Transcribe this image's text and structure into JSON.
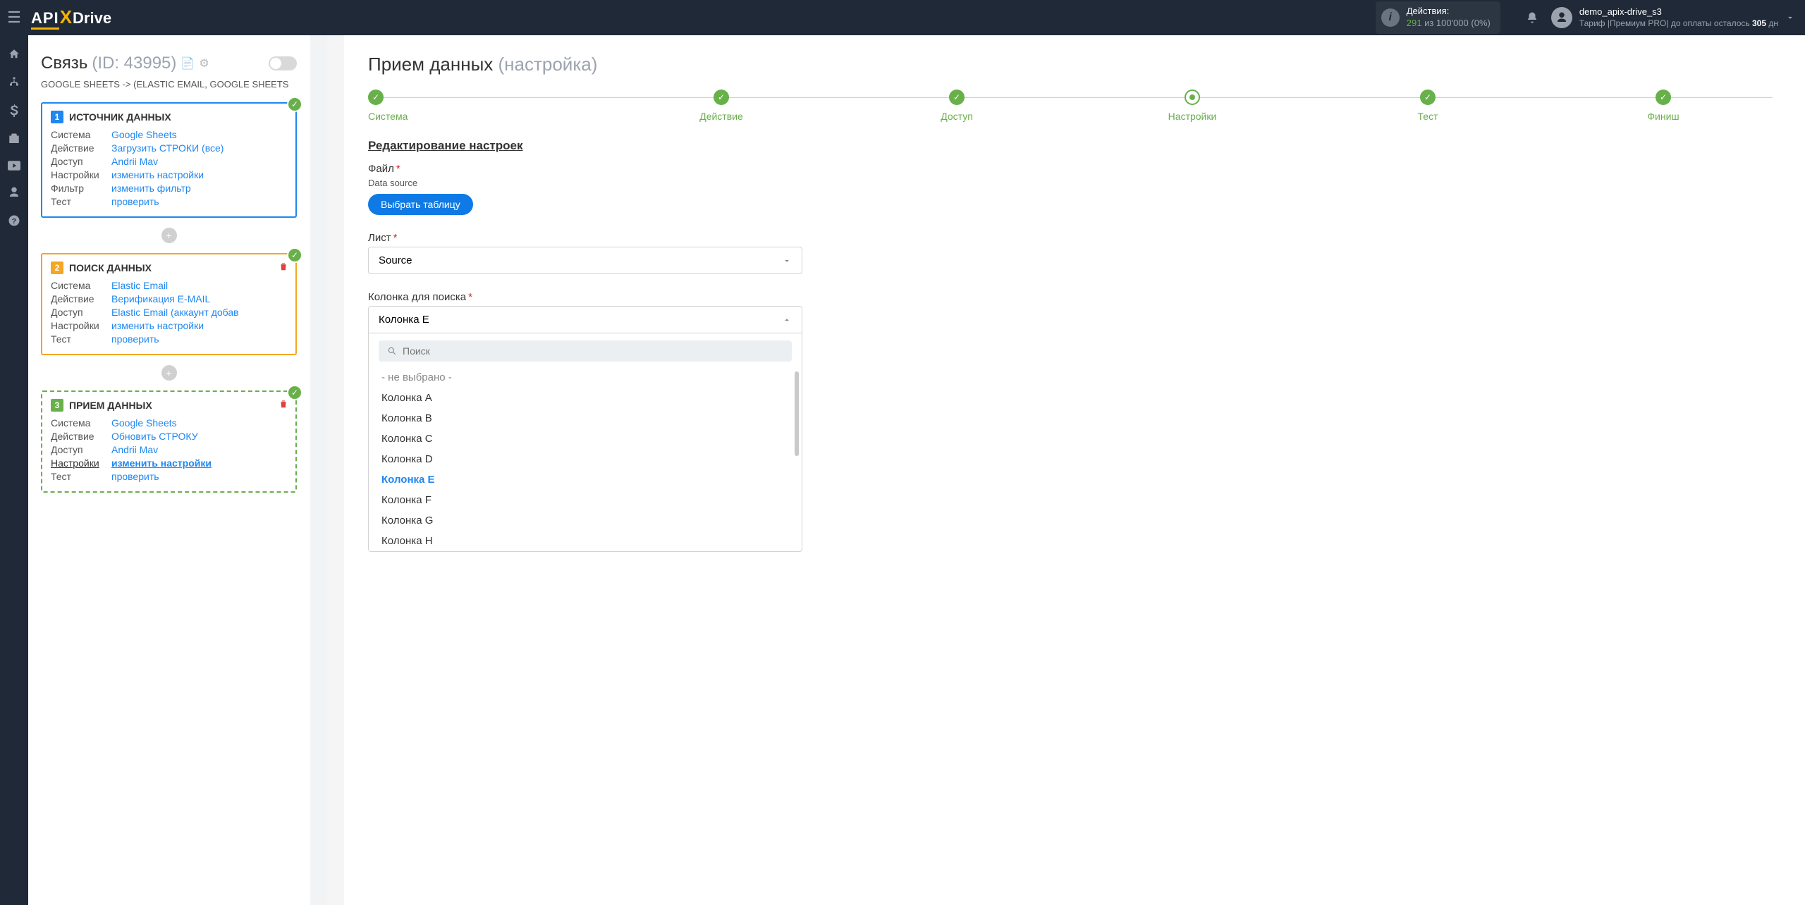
{
  "topbar": {
    "logo": {
      "part1": "API",
      "part2": "X",
      "part3": "Drive"
    },
    "actions_label": "Действия:",
    "actions_count": "291",
    "actions_mid": " из ",
    "actions_total": "100'000",
    "actions_pct": " (0%)",
    "user_name": "demo_apix-drive_s3",
    "plan_prefix": "Тариф |Премиум PRO| до оплаты осталось ",
    "plan_days": "305",
    "plan_suffix": " дн"
  },
  "sidebar_icons": [
    "home-icon",
    "sitemap-icon",
    "dollar-icon",
    "briefcase-icon",
    "video-icon",
    "user-icon",
    "help-icon"
  ],
  "connection": {
    "title": "Связь",
    "id": "(ID: 43995)",
    "breadcrumb": "GOOGLE SHEETS -> (elastic email, google sheets",
    "blocks": [
      {
        "color": "blue",
        "num": "1",
        "title": "ИСТОЧНИК ДАННЫХ",
        "deletable": false,
        "rows": [
          {
            "k": "Система",
            "v": "Google Sheets"
          },
          {
            "k": "Действие",
            "v": "Загрузить СТРОКИ (все)"
          },
          {
            "k": "Доступ",
            "v": "Andrii Mav"
          },
          {
            "k": "Настройки",
            "v": "изменить настройки"
          },
          {
            "k": "Фильтр",
            "v": "изменить фильтр"
          },
          {
            "k": "Тест",
            "v": "проверить"
          }
        ]
      },
      {
        "color": "orange",
        "num": "2",
        "title": "ПОИСК ДАННЫХ",
        "deletable": true,
        "rows": [
          {
            "k": "Система",
            "v": "Elastic Email"
          },
          {
            "k": "Действие",
            "v": "Верификация E-MAIL"
          },
          {
            "k": "Доступ",
            "v": "Elastic Email (аккаунт добав"
          },
          {
            "k": "Настройки",
            "v": "изменить настройки"
          },
          {
            "k": "Тест",
            "v": "проверить"
          }
        ]
      },
      {
        "color": "green",
        "num": "3",
        "title": "ПРИЕМ ДАННЫХ",
        "deletable": true,
        "rows": [
          {
            "k": "Система",
            "v": "Google Sheets"
          },
          {
            "k": "Действие",
            "v": "Обновить СТРОКУ"
          },
          {
            "k": "Доступ",
            "v": "Andrii Mav"
          },
          {
            "k": "Настройки",
            "v": "изменить настройки",
            "bold": true
          },
          {
            "k": "Тест",
            "v": "проверить"
          }
        ]
      }
    ]
  },
  "main": {
    "title": "Прием данных",
    "title_sub": "(настройка)",
    "steps": [
      "Система",
      "Действие",
      "Доступ",
      "Настройки",
      "Тест",
      "Финиш"
    ],
    "current_step_index": 3,
    "section_title": "Редактирование настроек",
    "file": {
      "label": "Файл",
      "sub": "Data source",
      "button": "Выбрать таблицу"
    },
    "sheet": {
      "label": "Лист",
      "value": "Source"
    },
    "column": {
      "label": "Колонка для поиска",
      "value": "Колонка E",
      "search_placeholder": "Поиск",
      "options": [
        "- не выбрано -",
        "Колонка A",
        "Колонка B",
        "Колонка C",
        "Колонка D",
        "Колонка E",
        "Колонка F",
        "Колонка G",
        "Колонка H"
      ],
      "selected": "Колонка E"
    }
  }
}
